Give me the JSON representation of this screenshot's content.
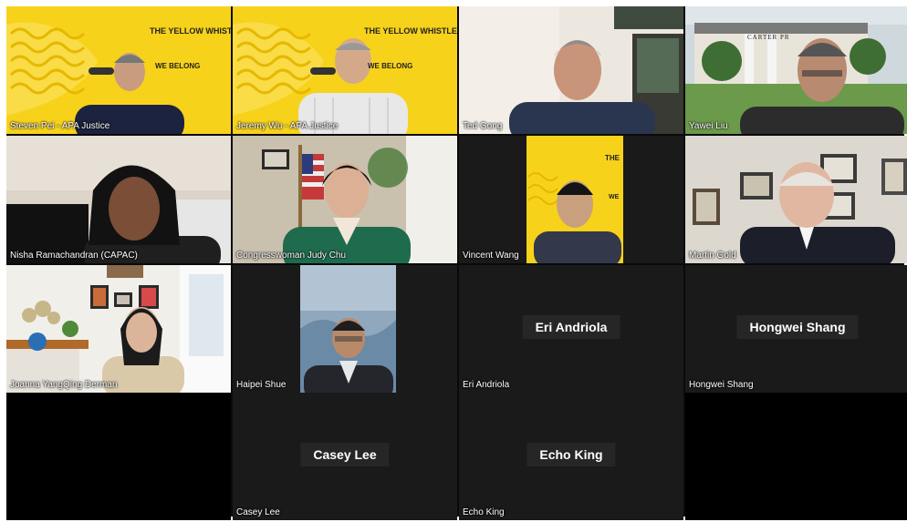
{
  "banner": {
    "line1": "THE YELLOW WHISTLE",
    "line2": "WE BELONG"
  },
  "participants": [
    {
      "id": "steven-pei",
      "name": "Steven Pei - APA Justice"
    },
    {
      "id": "jeremy-wu",
      "name": "Jeremy Wu - APA Justice"
    },
    {
      "id": "ted-gong",
      "name": "Ted Gong"
    },
    {
      "id": "yawei-liu",
      "name": "Yawei Liu"
    },
    {
      "id": "nisha-ramachandran",
      "name": "Nisha Ramachandran (CAPAC)"
    },
    {
      "id": "judy-chu",
      "name": "Congresswoman Judy Chu"
    },
    {
      "id": "vincent-wang",
      "name": "Vincent Wang"
    },
    {
      "id": "martin-gold",
      "name": "Martin Gold"
    },
    {
      "id": "joanna-derman",
      "name": "Joanna YangQing Derman"
    },
    {
      "id": "haipei-shue",
      "name": "Haipei Shue"
    },
    {
      "id": "eri-andriola",
      "name": "Eri Andriola",
      "display": "Eri Andriola"
    },
    {
      "id": "hongwei-shang",
      "name": "Hongwei Shang",
      "display": "Hongwei Shang"
    },
    {
      "id": "casey-lee",
      "name": "Casey Lee",
      "display": "Casey Lee"
    },
    {
      "id": "echo-king",
      "name": "Echo King",
      "display": "Echo King"
    }
  ],
  "building_sign": "CARTER PR",
  "colors": {
    "banner_yellow": "#f7d21a",
    "tile_dark": "#1a1a1a",
    "name_text": "#ffffff"
  }
}
